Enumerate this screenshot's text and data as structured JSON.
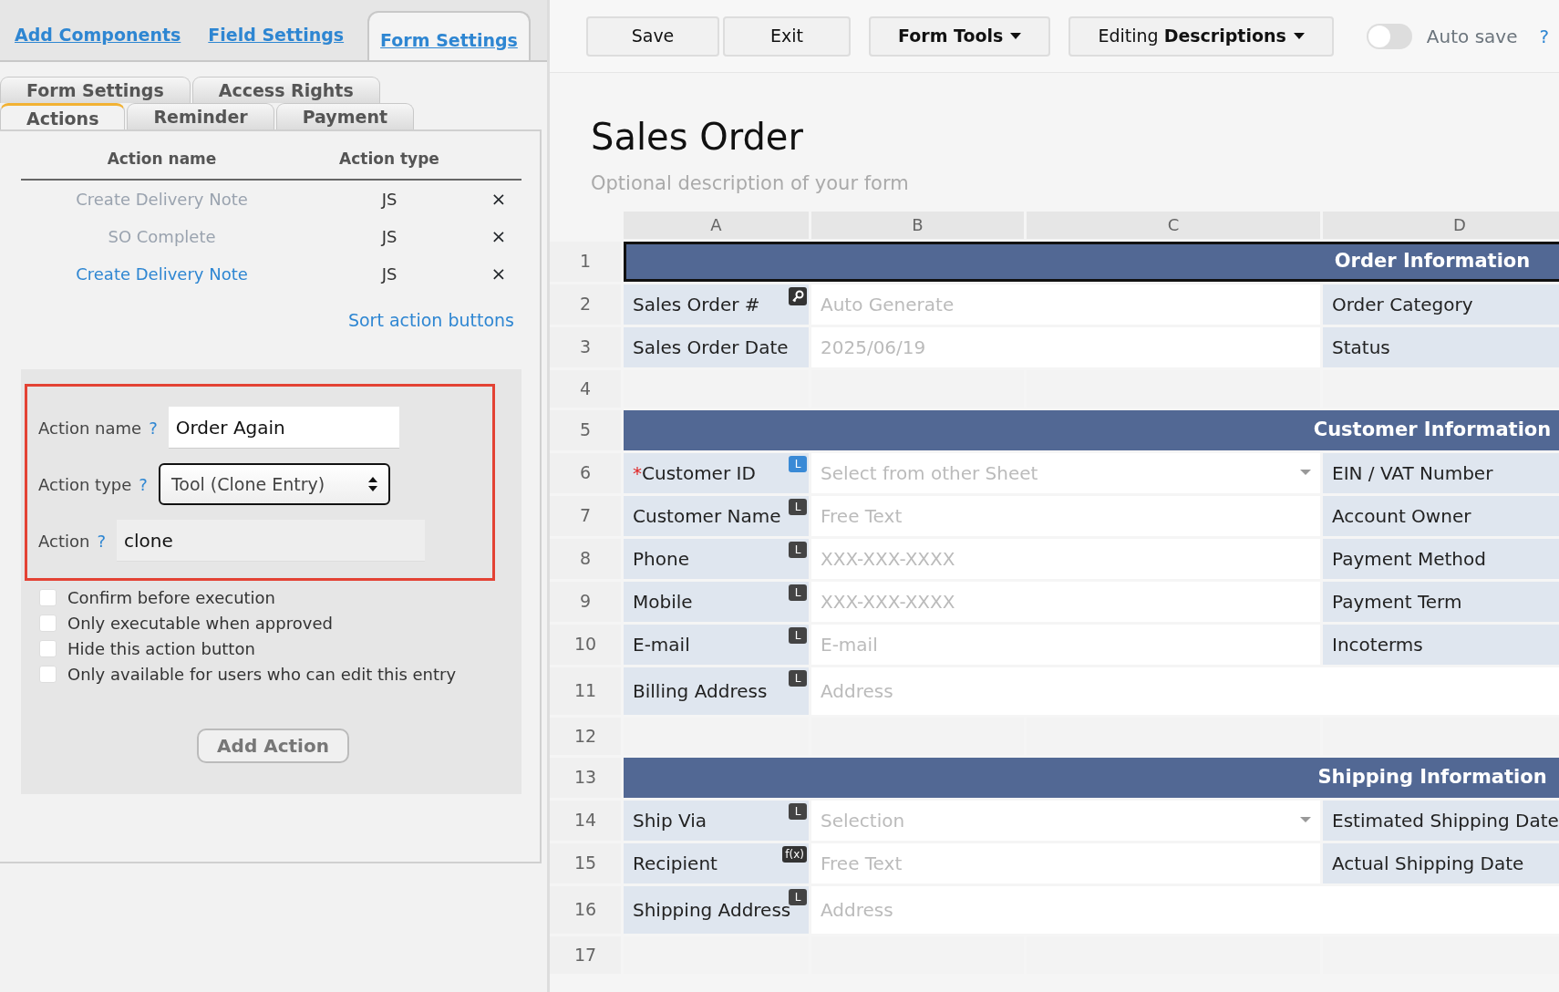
{
  "left_panel": {
    "top_tabs": [
      {
        "label": "Add Components",
        "selected": false
      },
      {
        "label": "Field Settings",
        "selected": false
      },
      {
        "label": "Form Settings",
        "selected": true
      }
    ],
    "sub_tabs": [
      [
        {
          "label": "Form Settings",
          "selected": false
        },
        {
          "label": "Access Rights",
          "selected": false
        }
      ],
      [
        {
          "label": "Actions",
          "selected": true
        },
        {
          "label": "Reminder",
          "selected": false
        },
        {
          "label": "Payment",
          "selected": false
        }
      ]
    ],
    "actions_table": {
      "columns": [
        "Action name",
        "Action type"
      ],
      "rows": [
        {
          "name": "Create Delivery Note",
          "type": "JS",
          "delete": "×",
          "disabled": true
        },
        {
          "name": "SO Complete",
          "type": "JS",
          "delete": "×",
          "disabled": true
        },
        {
          "name": "Create Delivery Note",
          "type": "JS",
          "delete": "×",
          "disabled": false
        }
      ]
    },
    "sort_link": "Sort action buttons",
    "form": {
      "fields": [
        {
          "kind": "input",
          "label": "Action name",
          "help": "?",
          "value": "Order Again"
        },
        {
          "kind": "select",
          "label": "Action type",
          "help": "?",
          "value": "Tool (Clone Entry)"
        },
        {
          "kind": "readonly",
          "label": "Action",
          "help": "?",
          "value": "clone"
        }
      ],
      "options": [
        {
          "label": "Confirm before execution",
          "checked": false
        },
        {
          "label": "Only executable when approved",
          "checked": false
        },
        {
          "label": "Hide this action button",
          "checked": false
        },
        {
          "label": "Only available for users who can edit this entry",
          "checked": false
        }
      ],
      "add_button": "Add Action"
    }
  },
  "toolbar": {
    "buttons": [
      {
        "label": "Save",
        "kind": "plain"
      },
      {
        "label": "Exit",
        "kind": "plain"
      },
      {
        "label": "Form Tools",
        "kind": "menu"
      },
      {
        "label": "Editing **Descriptions**",
        "kind": "menu"
      }
    ],
    "auto_save": {
      "label": "Auto save",
      "on": false,
      "help": "?"
    }
  },
  "form": {
    "title": "Sales Order",
    "description": "Optional description of your form"
  },
  "sheet": {
    "columns": [
      "A",
      "B",
      "C",
      "D"
    ],
    "rows": [
      {
        "number": "1",
        "kind": "header",
        "title": "Order Information",
        "selected": true
      },
      {
        "number": "2",
        "kind": "field",
        "label": "Sales Order #",
        "badge": {
          "kind": "key"
        },
        "placeholder": "Auto Generate",
        "right_label": "Order Category",
        "selected": false
      },
      {
        "number": "3",
        "kind": "field",
        "label": "Sales Order Date",
        "placeholder": "2025/06/19",
        "right_label": "Status",
        "selected": false
      },
      {
        "number": "4",
        "kind": "empty",
        "selected": false
      },
      {
        "number": "5",
        "kind": "header",
        "title": "Customer Information",
        "selected": false
      },
      {
        "number": "6",
        "kind": "field",
        "required_mark": "*",
        "label": "Customer ID",
        "badge": {
          "kind": "letter",
          "text": "L",
          "color": "#3a8ad6"
        },
        "placeholder": "Select from other Sheet",
        "dropdown": true,
        "right_label": "EIN / VAT Number",
        "selected": false
      },
      {
        "number": "7",
        "kind": "field",
        "label": "Customer Name",
        "badge": {
          "kind": "letter",
          "text": "L",
          "color": "#444444"
        },
        "placeholder": "Free Text",
        "right_label": "Account Owner",
        "selected": false
      },
      {
        "number": "8",
        "kind": "field",
        "label": "Phone",
        "badge": {
          "kind": "letter",
          "text": "L",
          "color": "#444444"
        },
        "placeholder": "XXX-XXX-XXXX",
        "right_label": "Payment Method",
        "selected": false
      },
      {
        "number": "9",
        "kind": "field",
        "label": "Mobile",
        "badge": {
          "kind": "letter",
          "text": "L",
          "color": "#444444"
        },
        "placeholder": "XXX-XXX-XXXX",
        "right_label": "Payment Term",
        "selected": false
      },
      {
        "number": "10",
        "kind": "field",
        "label": "E-mail",
        "badge": {
          "kind": "letter",
          "text": "L",
          "color": "#444444"
        },
        "placeholder": "E-mail",
        "right_label": "Incoterms",
        "selected": false
      },
      {
        "number": "11",
        "kind": "address",
        "label": "Billing Address",
        "badge": {
          "kind": "letter",
          "text": "L",
          "color": "#444444"
        },
        "placeholder": "Address",
        "selected": false
      },
      {
        "number": "12",
        "kind": "empty",
        "selected": false
      },
      {
        "number": "13",
        "kind": "header",
        "title": "Shipping Information",
        "selected": false
      },
      {
        "number": "14",
        "kind": "field",
        "label": "Ship Via",
        "badge": {
          "kind": "letter",
          "text": "L",
          "color": "#444444"
        },
        "placeholder": "Selection",
        "dropdown": true,
        "right_label": "Estimated Shipping Date",
        "selected": false
      },
      {
        "number": "15",
        "kind": "field",
        "label": "Recipient",
        "badge": {
          "kind": "letter",
          "text": "f(x)",
          "color": "#333333"
        },
        "placeholder": "Free Text",
        "right_label": "Actual Shipping Date",
        "selected": false
      },
      {
        "number": "16",
        "kind": "address",
        "label": "Shipping Address",
        "badge": {
          "kind": "letter",
          "text": "L",
          "color": "#444444"
        },
        "placeholder": "Address",
        "selected": false
      },
      {
        "number": "17",
        "kind": "empty",
        "selected": false
      }
    ]
  }
}
